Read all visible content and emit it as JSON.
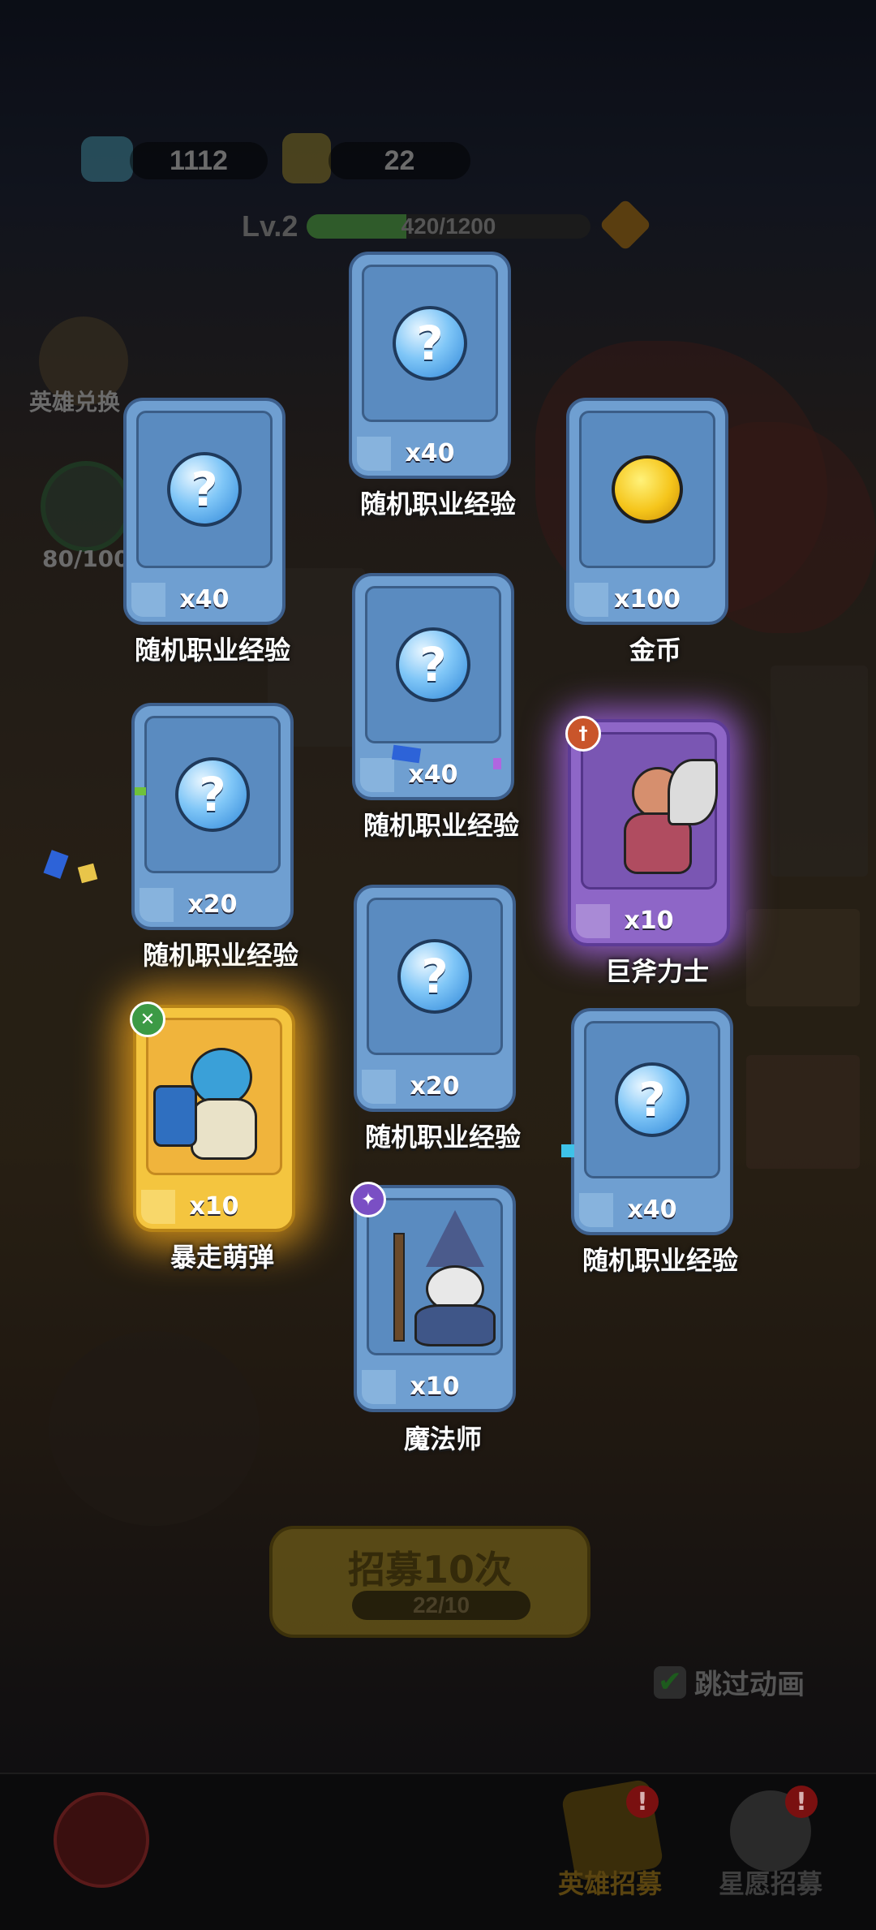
{
  "top_bar": {
    "gems": "1112",
    "tickets": "22",
    "level": "Lv.2",
    "exp_text": "420/1200",
    "exp_progress": 0.35
  },
  "side": {
    "hero_exchange": "英雄兑换",
    "star_progress": "80/100"
  },
  "cards": [
    {
      "label": "随机职业经验",
      "qty": "x40",
      "kind": "exp"
    },
    {
      "label": "随机职业经验",
      "qty": "x40",
      "kind": "exp"
    },
    {
      "label": "金币",
      "qty": "x100",
      "kind": "coin"
    },
    {
      "label": "随机职业经验",
      "qty": "x40",
      "kind": "exp"
    },
    {
      "label": "随机职业经验",
      "qty": "x20",
      "kind": "exp"
    },
    {
      "label": "巨斧力士",
      "qty": "x10",
      "kind": "hero-purple"
    },
    {
      "label": "随机职业经验",
      "qty": "x20",
      "kind": "exp"
    },
    {
      "label": "暴走萌弹",
      "qty": "x10",
      "kind": "hero-gold"
    },
    {
      "label": "随机职业经验",
      "qty": "x40",
      "kind": "exp"
    },
    {
      "label": "魔法师",
      "qty": "x10",
      "kind": "hero-blue"
    }
  ],
  "recruit": {
    "label": "招募10次",
    "count": "22/10"
  },
  "skip_animation": {
    "label": "跳过动画",
    "checked": true
  },
  "bottom_nav": {
    "hero_recruit": "英雄招募",
    "wish_recruit": "星愿招募",
    "badge": "!"
  },
  "colors": {
    "card_blue": "#6f9fd1",
    "card_purple": "#8e66c7",
    "card_gold": "#f4c53f"
  }
}
